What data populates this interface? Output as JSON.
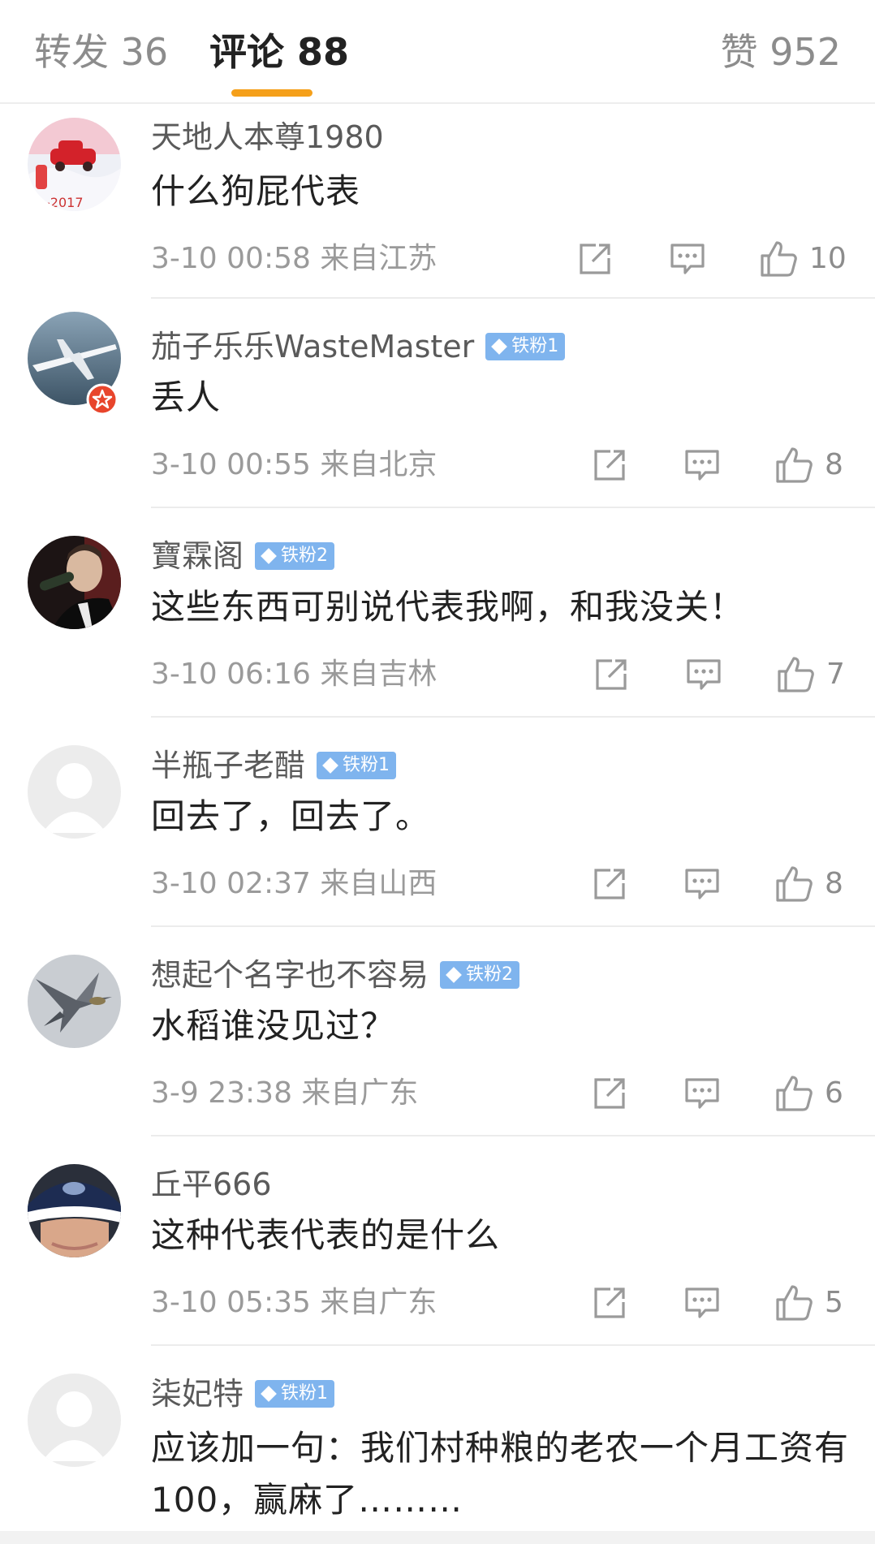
{
  "tabs": {
    "repost": "转发 36",
    "comments": "评论 88",
    "likes": "赞 952"
  },
  "colors": {
    "accent_indicator": "#f5a01a",
    "fan_badge": "#7fb4ee",
    "verified_badge": "#e8452c"
  },
  "comments": [
    {
      "author": "天地人本尊1980",
      "badge": "",
      "text": "什么狗屁代表",
      "meta": "3-10 00:58  来自江苏",
      "likes": "10",
      "avatar": "red-car-snow-avatar"
    },
    {
      "author": "茄子乐乐WasteMaster",
      "badge": "铁粉1",
      "text": "丢人",
      "meta": "3-10 00:55  来自北京",
      "likes": "8",
      "avatar": "airplane-avatar"
    },
    {
      "author": "寶霖阁",
      "badge": "铁粉2",
      "text": "这些东西可别说代表我啊，和我没关！",
      "meta": "3-10 06:16  来自吉林",
      "likes": "7",
      "avatar": "man-drinking-avatar"
    },
    {
      "author": "半瓶子老醋",
      "badge": "铁粉1",
      "text": "回去了，回去了。",
      "meta": "3-10 02:37  来自山西",
      "likes": "8",
      "avatar": "default-avatar"
    },
    {
      "author": "想起个名字也不容易",
      "badge": "铁粉2",
      "text": "水稻谁没见过？",
      "meta": "3-9 23:38  来自广东",
      "likes": "6",
      "avatar": "fighter-jet-avatar"
    },
    {
      "author": "丘平666",
      "badge": "",
      "text": "这种代表代表的是什么",
      "meta": "3-10 05:35  来自广东",
      "likes": "5",
      "avatar": "cap-avatar"
    },
    {
      "author": "柒妃特",
      "badge": "铁粉1",
      "text": "应该加一句：我们村种粮的老农一个月工资有100，赢麻了………",
      "meta": "",
      "likes": "",
      "avatar": "default-avatar"
    }
  ]
}
